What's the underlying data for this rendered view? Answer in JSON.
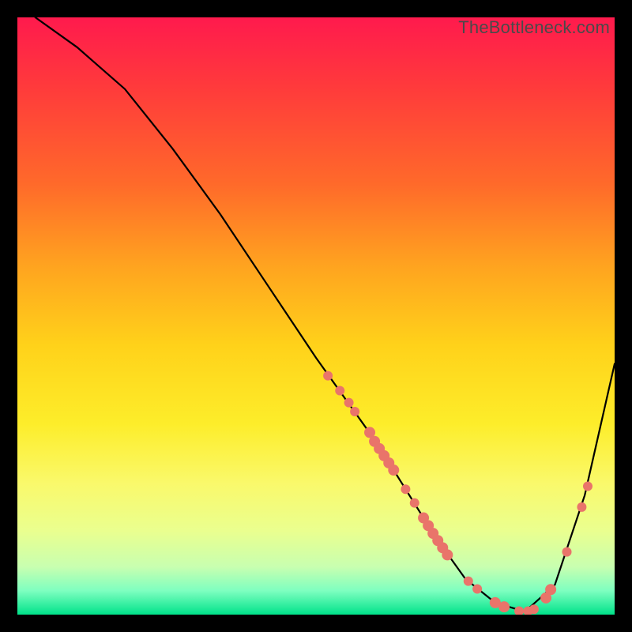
{
  "watermark": "TheBottleneck.com",
  "chart_data": {
    "type": "line",
    "title": "",
    "xlabel": "",
    "ylabel": "",
    "xlim": [
      0,
      100
    ],
    "ylim": [
      0,
      100
    ],
    "curve": {
      "x": [
        3,
        10,
        18,
        26,
        34,
        42,
        50,
        55,
        60,
        65,
        70,
        75,
        80,
        85,
        90,
        95,
        100
      ],
      "y": [
        100,
        95,
        88,
        78,
        67,
        55,
        43,
        36,
        29,
        21,
        13,
        6,
        2,
        0.5,
        5,
        20,
        42
      ]
    },
    "minimum_x": 85,
    "markers": [
      {
        "x": 52,
        "y": 40,
        "r": 6
      },
      {
        "x": 54,
        "y": 37.5,
        "r": 6
      },
      {
        "x": 55.5,
        "y": 35.5,
        "r": 6
      },
      {
        "x": 56.5,
        "y": 34,
        "r": 6
      },
      {
        "x": 59,
        "y": 30.5,
        "r": 7
      },
      {
        "x": 59.8,
        "y": 29,
        "r": 7
      },
      {
        "x": 60.6,
        "y": 27.8,
        "r": 7
      },
      {
        "x": 61.4,
        "y": 26.6,
        "r": 7
      },
      {
        "x": 62.2,
        "y": 25.4,
        "r": 7
      },
      {
        "x": 63,
        "y": 24.2,
        "r": 7
      },
      {
        "x": 65,
        "y": 21,
        "r": 6
      },
      {
        "x": 66.5,
        "y": 18.7,
        "r": 6
      },
      {
        "x": 68,
        "y": 16.2,
        "r": 7
      },
      {
        "x": 68.8,
        "y": 14.9,
        "r": 7
      },
      {
        "x": 69.6,
        "y": 13.6,
        "r": 7
      },
      {
        "x": 70.4,
        "y": 12.4,
        "r": 7
      },
      {
        "x": 71.2,
        "y": 11.2,
        "r": 7
      },
      {
        "x": 72,
        "y": 10,
        "r": 7
      },
      {
        "x": 75.5,
        "y": 5.6,
        "r": 6
      },
      {
        "x": 77,
        "y": 4.3,
        "r": 6
      },
      {
        "x": 80,
        "y": 2,
        "r": 7
      },
      {
        "x": 81.5,
        "y": 1.3,
        "r": 7
      },
      {
        "x": 84,
        "y": 0.6,
        "r": 6
      },
      {
        "x": 85.5,
        "y": 0.6,
        "r": 6
      },
      {
        "x": 86.5,
        "y": 0.9,
        "r": 6
      },
      {
        "x": 88.5,
        "y": 2.8,
        "r": 7
      },
      {
        "x": 89.3,
        "y": 4.2,
        "r": 7
      },
      {
        "x": 92,
        "y": 10.5,
        "r": 6
      },
      {
        "x": 94.5,
        "y": 18,
        "r": 6
      },
      {
        "x": 95.5,
        "y": 21.5,
        "r": 6
      }
    ]
  }
}
